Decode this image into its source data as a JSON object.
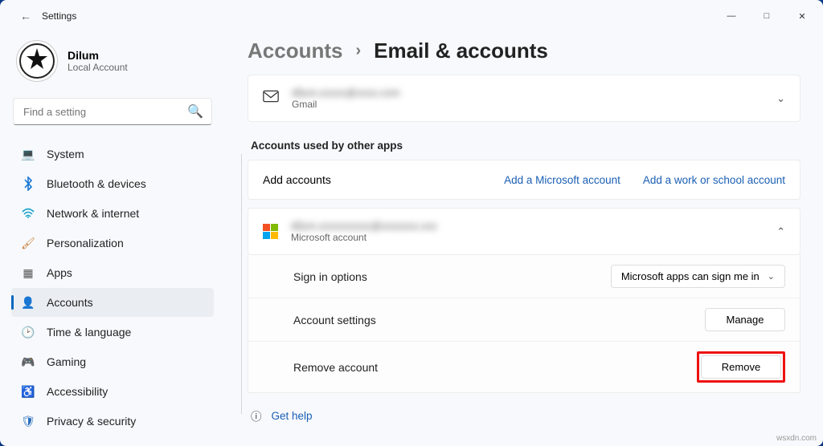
{
  "window": {
    "title": "Settings"
  },
  "profile": {
    "name": "Dilum",
    "subtitle": "Local Account"
  },
  "search": {
    "placeholder": "Find a setting"
  },
  "nav": [
    {
      "label": "System"
    },
    {
      "label": "Bluetooth & devices"
    },
    {
      "label": "Network & internet"
    },
    {
      "label": "Personalization"
    },
    {
      "label": "Apps"
    },
    {
      "label": "Accounts"
    },
    {
      "label": "Time & language"
    },
    {
      "label": "Gaming"
    },
    {
      "label": "Accessibility"
    },
    {
      "label": "Privacy & security"
    }
  ],
  "breadcrumb": {
    "root": "Accounts",
    "page": "Email & accounts"
  },
  "gmail": {
    "email": "dilum.xxxxx@xxxx.com",
    "provider": "Gmail"
  },
  "section2": {
    "title": "Accounts used by other apps"
  },
  "add": {
    "label": "Add accounts",
    "ms": "Add a Microsoft account",
    "work": "Add a work or school account"
  },
  "msacct": {
    "email": "dilum.xxxxxxxxxx@xxxxxxx.xxx",
    "provider": "Microsoft account"
  },
  "rows": {
    "signin": {
      "label": "Sign in options",
      "value": "Microsoft apps can sign me in"
    },
    "settings": {
      "label": "Account settings",
      "button": "Manage"
    },
    "remove": {
      "label": "Remove account",
      "button": "Remove"
    }
  },
  "help": "Get help",
  "watermark": "wsxdn.com"
}
